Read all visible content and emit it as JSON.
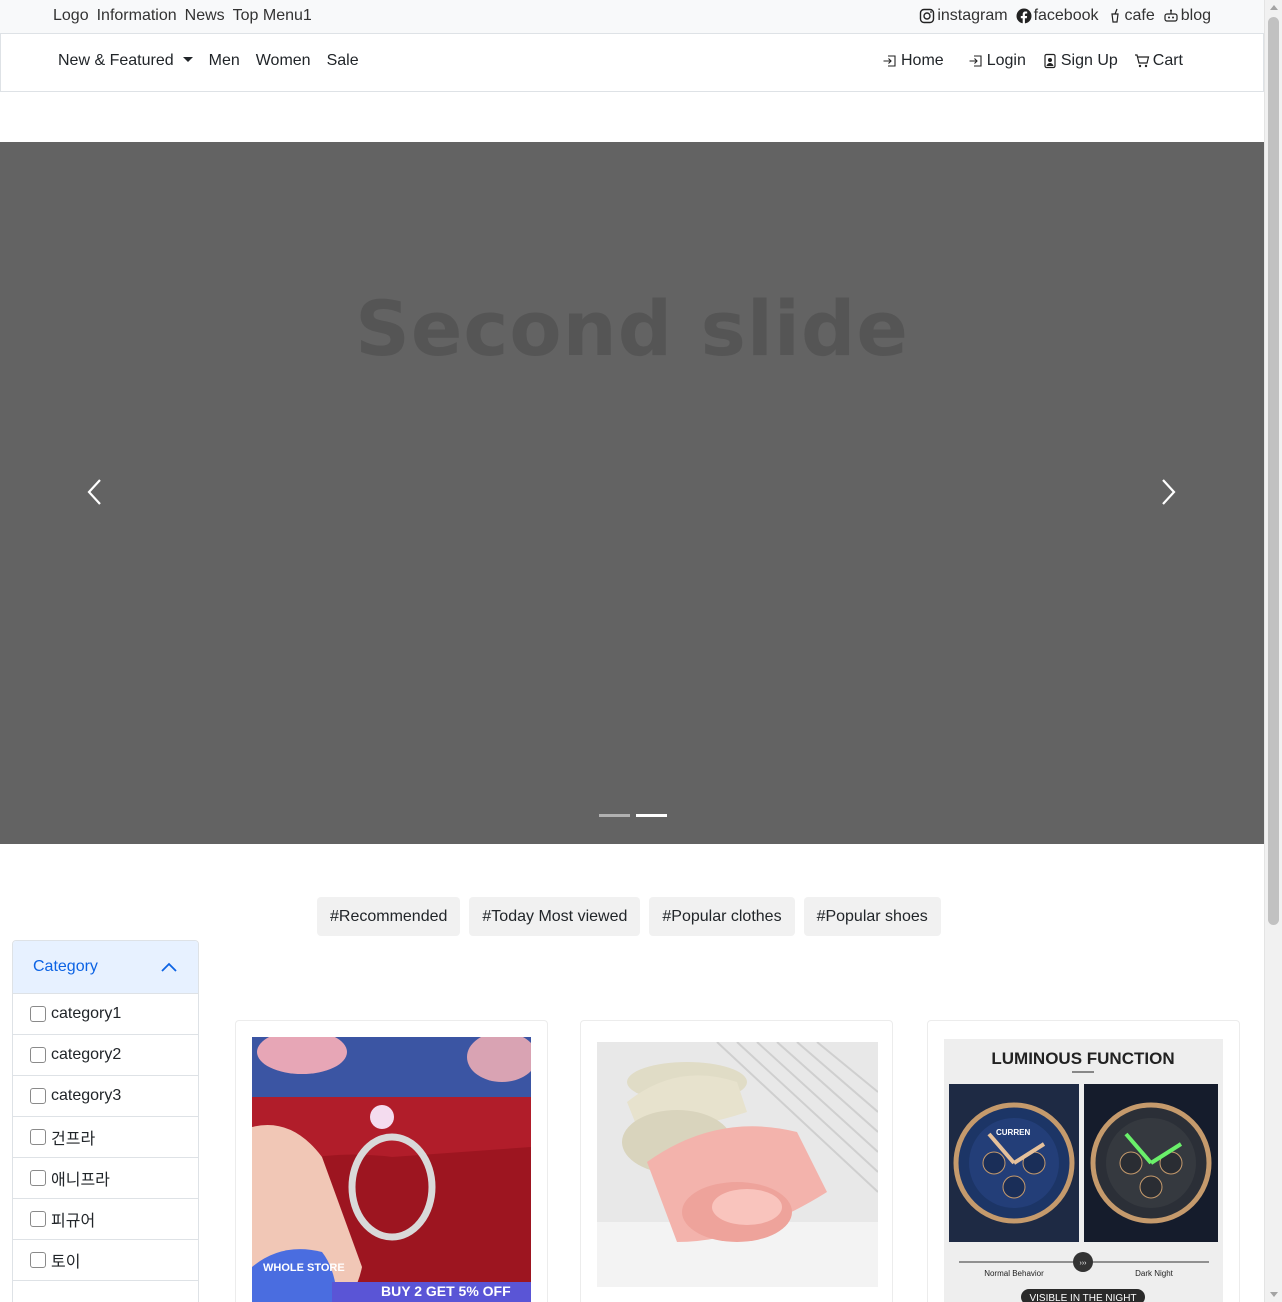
{
  "topbar": {
    "left_links": [
      "Logo",
      "Information",
      "News",
      "Top Menu1"
    ],
    "social": [
      {
        "label": "instagram",
        "icon": "instagram-icon"
      },
      {
        "label": "facebook",
        "icon": "facebook-icon"
      },
      {
        "label": "cafe",
        "icon": "cup-icon"
      },
      {
        "label": "blog",
        "icon": "robot-icon"
      }
    ]
  },
  "navbar": {
    "dropdown_label": "New & Featured",
    "links": [
      "Men",
      "Women",
      "Sale"
    ],
    "right": [
      {
        "label": "Home",
        "icon": "box-arrow-in-right-icon"
      },
      {
        "label": "Login",
        "icon": "box-arrow-in-right-icon"
      },
      {
        "label": "Sign Up",
        "icon": "person-badge-icon"
      },
      {
        "label": "Cart",
        "icon": "cart-icon"
      }
    ]
  },
  "carousel": {
    "slide_text": "Second slide",
    "active_index": 1,
    "slide_count": 2,
    "background": "#636363"
  },
  "tags": [
    "#Recommended",
    "#Today Most viewed",
    "#Popular clothes",
    "#Popular shoes"
  ],
  "sidebar": {
    "heading": "Category",
    "items": [
      "category1",
      "category2",
      "category3",
      "건프라",
      "애니프라",
      "피규어",
      "토이"
    ]
  },
  "products": [
    {
      "badge_text": "WHOLE STORE",
      "promo_text": "BUY 2 GET 5% OFF"
    },
    {},
    {
      "headline": "LUMINOUS FUNCTION",
      "label_left": "Normal Behavior",
      "label_right": "Dark Night",
      "footer": "VISIBLE IN THE NIGHT",
      "brand": "CURREN"
    }
  ],
  "colors": {
    "accent": "#0c63e4",
    "accordion_bg": "#e7f1ff",
    "tag_bg": "#f1f1f1"
  }
}
